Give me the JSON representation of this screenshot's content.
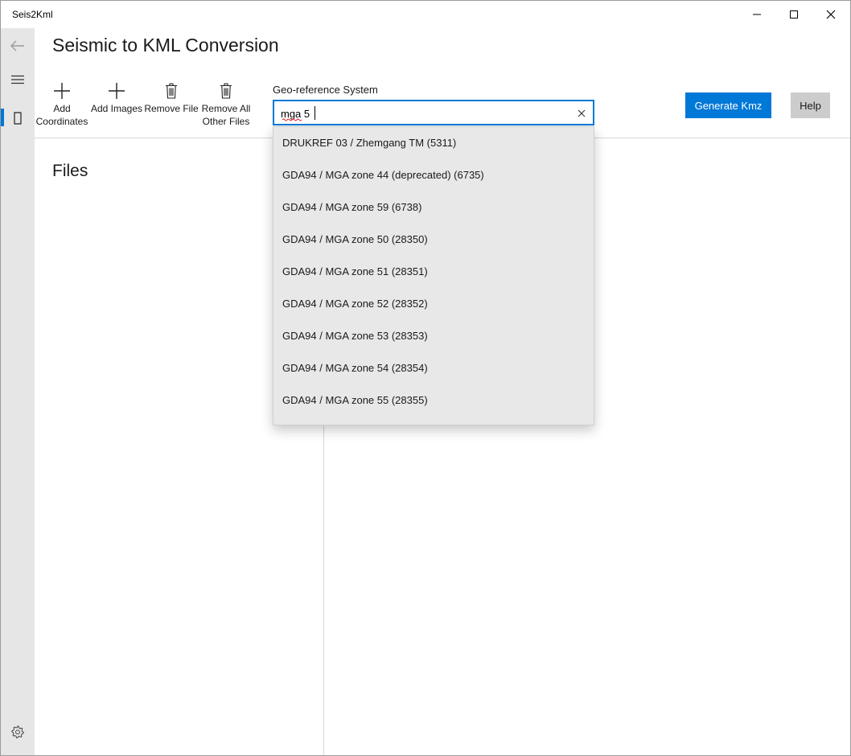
{
  "app": {
    "title": "Seis2Kml"
  },
  "page": {
    "title": "Seismic to KML Conversion"
  },
  "toolbar": {
    "add_coordinates": [
      "Add",
      "Coordinates"
    ],
    "add_images": "Add Images",
    "remove_file": "Remove File",
    "remove_all": [
      "Remove All",
      "Other Files"
    ]
  },
  "geo": {
    "label": "Geo-reference System",
    "value": "mga 5",
    "options": [
      "DRUKREF 03 / Zhemgang TM (5311)",
      "GDA94 / MGA zone 44 (deprecated) (6735)",
      "GDA94 / MGA zone 59 (6738)",
      "GDA94 / MGA zone 50 (28350)",
      "GDA94 / MGA zone 51 (28351)",
      "GDA94 / MGA zone 52 (28352)",
      "GDA94 / MGA zone 53 (28353)",
      "GDA94 / MGA zone 54 (28354)",
      "GDA94 / MGA zone 55 (28355)"
    ]
  },
  "actions": {
    "generate": "Generate Kmz",
    "help": "Help"
  },
  "files": {
    "title": "Files"
  },
  "icons": {
    "back": "arrow-left-icon",
    "menu": "hamburger-icon",
    "page": "page-icon",
    "settings": "gear-icon",
    "add": "plus-icon",
    "remove": "trash-icon",
    "clear": "close-icon"
  },
  "colors": {
    "accent": "#0078d7",
    "rail": "#e6e6e6",
    "dropdown": "#e8e8e8"
  }
}
